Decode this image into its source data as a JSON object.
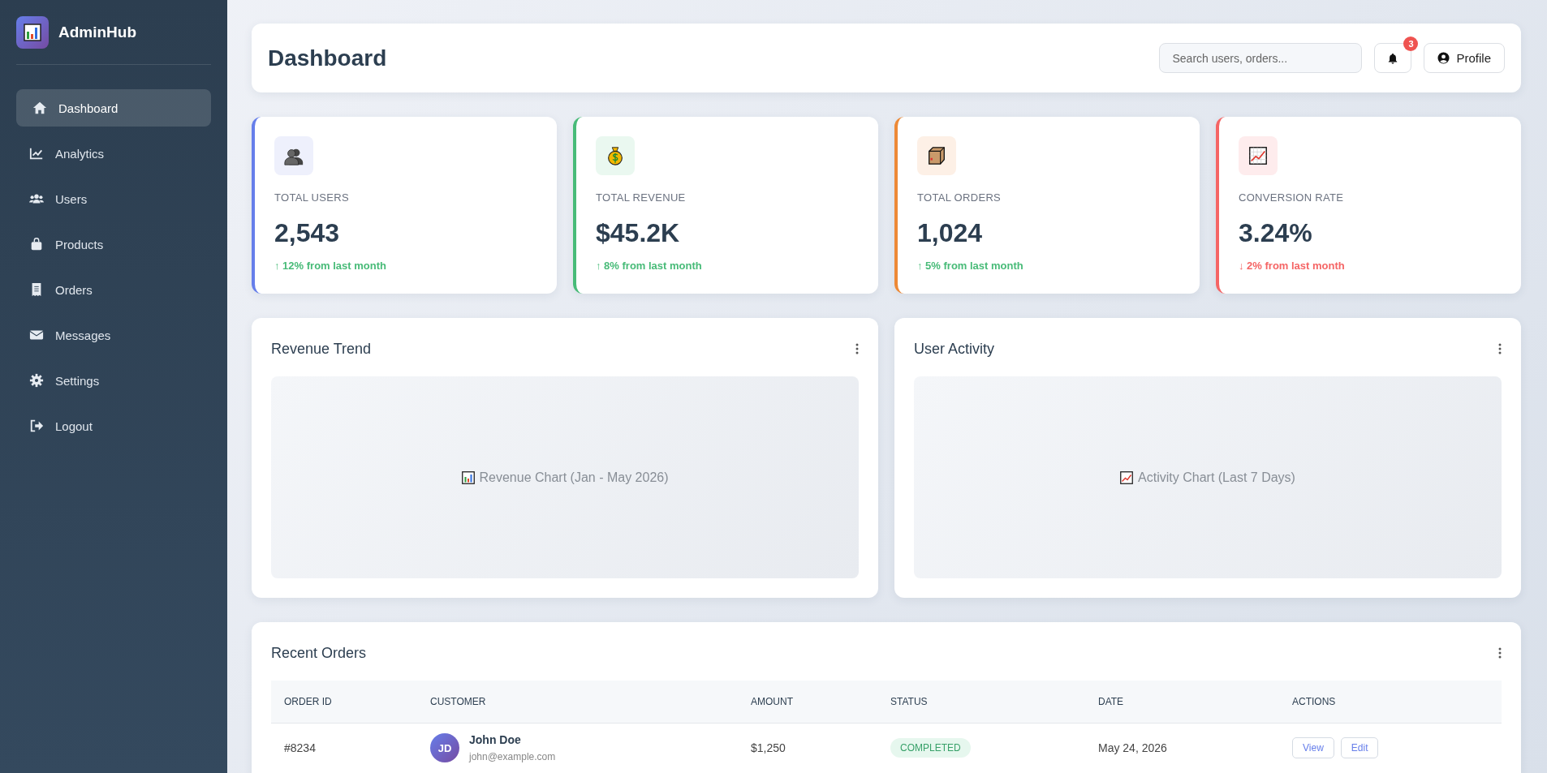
{
  "sidebar": {
    "brand": "AdminHub",
    "items": [
      {
        "label": "Dashboard",
        "selected": true
      },
      {
        "label": "Analytics",
        "selected": false
      },
      {
        "label": "Users",
        "selected": false
      },
      {
        "label": "Products",
        "selected": false
      },
      {
        "label": "Orders",
        "selected": false
      },
      {
        "label": "Messages",
        "selected": false
      },
      {
        "label": "Settings",
        "selected": false
      },
      {
        "label": "Logout",
        "selected": false
      }
    ]
  },
  "header": {
    "title": "Dashboard",
    "search": {
      "placeholder": "Search users, orders..."
    },
    "notifications": {
      "badge": "3"
    },
    "profile_button": "Profile"
  },
  "stats": [
    {
      "color": "#667eea",
      "label": "TOTAL USERS",
      "value": "2,543",
      "change": "↑ 12% from last month",
      "kind": "up"
    },
    {
      "color": "#48bb78",
      "label": "TOTAL REVENUE",
      "value": "$45.2K",
      "change": "↑ 8% from last month",
      "kind": "up"
    },
    {
      "color": "#ed8936",
      "label": "TOTAL ORDERS",
      "value": "1,024",
      "change": "↑ 5% from last month",
      "kind": "up"
    },
    {
      "color": "#f56565",
      "label": "CONVERSION RATE",
      "value": "3.24%",
      "change": "↓ 2% from last month",
      "kind": "down"
    }
  ],
  "charts": [
    {
      "title": "Revenue Trend",
      "placeholder": "Revenue Chart (Jan - May 2026)"
    },
    {
      "title": "User Activity",
      "placeholder": "Activity Chart (Last 7 Days)"
    }
  ],
  "orders": {
    "title": "Recent Orders",
    "columns": [
      "ORDER ID",
      "CUSTOMER",
      "AMOUNT",
      "STATUS",
      "DATE",
      "ACTIONS"
    ],
    "rows": [
      {
        "order_id": "#8234",
        "initials": "JD",
        "name": "John Doe",
        "email": "john@example.com",
        "amount": "$1,250",
        "status": "COMPLETED",
        "kind": "completed",
        "date": "May 24, 2026",
        "actions": [
          "View",
          "Edit"
        ]
      }
    ]
  }
}
